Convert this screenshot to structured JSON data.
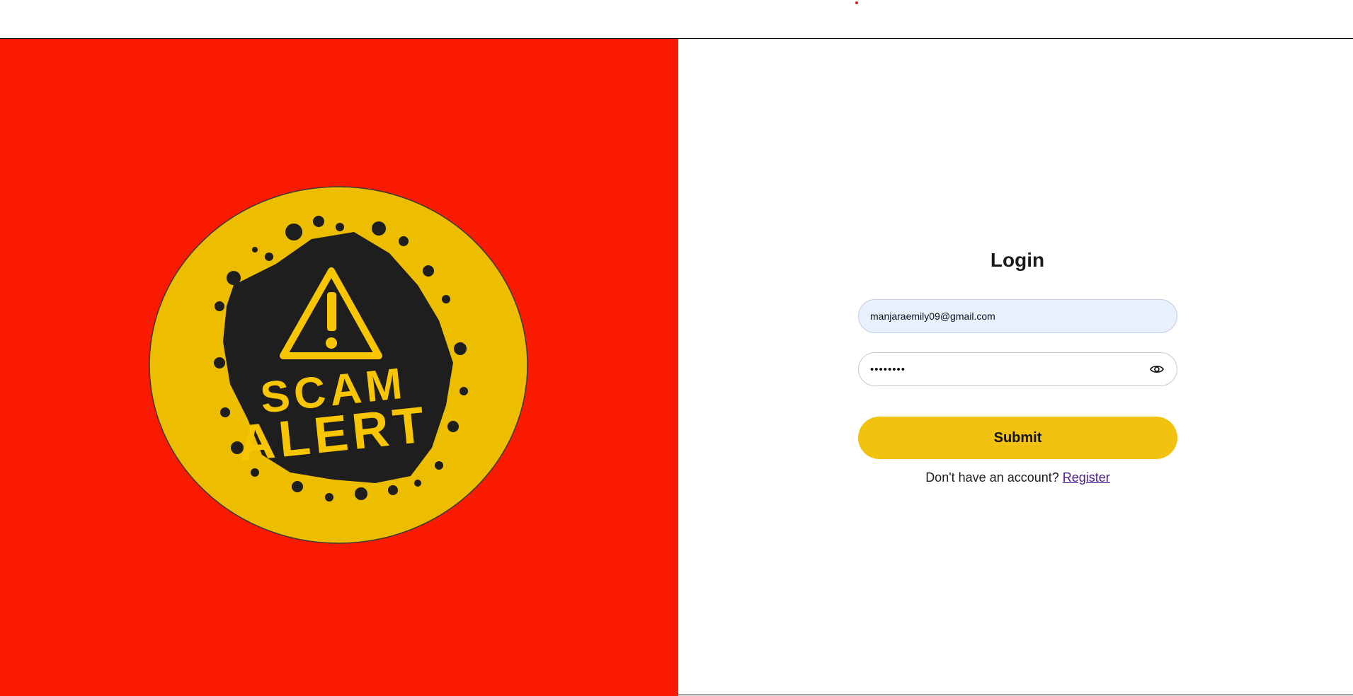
{
  "login": {
    "title": "Login",
    "email_value": "manjaraemily09@gmail.com",
    "password_value": "••••••••",
    "submit_label": "Submit",
    "register_prompt": "Don't have an account? ",
    "register_link": "Register"
  },
  "banner": {
    "line1": "SCAM",
    "line2": "ALERT",
    "colors": {
      "background": "#fa1a00",
      "circle": "#edbe00",
      "splat": "#1e1e1e",
      "text": "#f7c600"
    }
  },
  "icons": {
    "password_toggle": "eye-icon",
    "warning": "warning-triangle-icon"
  }
}
